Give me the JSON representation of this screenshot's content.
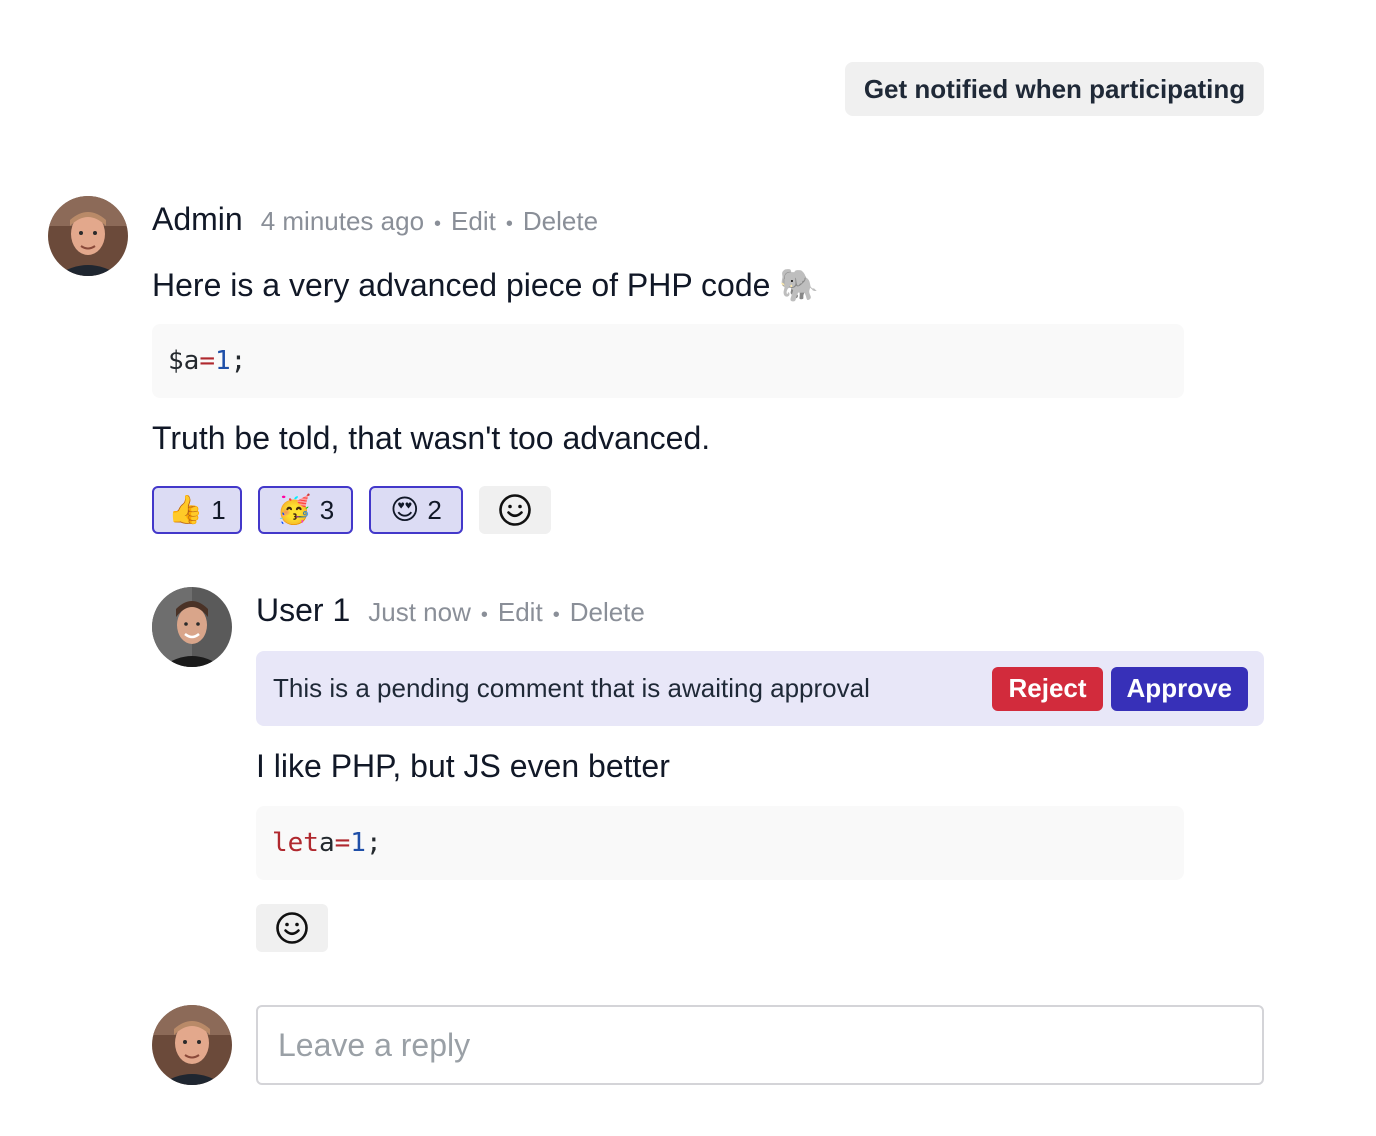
{
  "header": {
    "notify_label": "Get notified when participating"
  },
  "comment": {
    "author": "Admin",
    "time": "4 minutes ago",
    "edit_label": "Edit",
    "delete_label": "Delete",
    "intro": "Here is a very advanced piece of PHP code 🐘",
    "code": {
      "var": "$a",
      "op": "=",
      "num": "1",
      "end": ";"
    },
    "outro": "Truth be told, that wasn't too advanced.",
    "reactions": [
      {
        "emoji": "👍",
        "count": "1"
      },
      {
        "emoji": "🥳",
        "count": "3"
      },
      {
        "emoji": "😍",
        "count": "2"
      }
    ]
  },
  "reply": {
    "author": "User 1",
    "time": "Just now",
    "edit_label": "Edit",
    "delete_label": "Delete",
    "pending_message": "This is a pending comment that is awaiting approval",
    "reject_label": "Reject",
    "approve_label": "Approve",
    "text": "I like PHP, but JS even better",
    "code": {
      "kw": "let",
      "var": "a",
      "op": "=",
      "num": "1",
      "end": ";"
    }
  },
  "reply_box": {
    "placeholder": "Leave a reply"
  },
  "colors": {
    "accent": "#3730b8",
    "reject": "#d22b3c",
    "reaction_bg": "#dcdcf4",
    "pending_bg": "#e8e7f8"
  },
  "icons": {
    "add_reaction": "smiley-icon"
  }
}
